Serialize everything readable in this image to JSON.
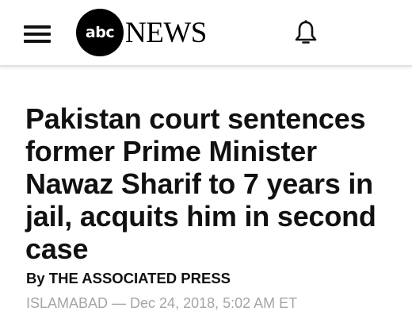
{
  "header": {
    "menu_icon": "hamburger-menu-icon",
    "logo": {
      "circle_text": "abc",
      "wordmark": "NEWS"
    },
    "notification_icon": "bell-icon"
  },
  "article": {
    "headline": "Pakistan court sentences former Prime Minister Nawaz Sharif to 7 years in jail, acquits him in second case",
    "byline": "By THE ASSOCIATED PRESS",
    "dateline": "ISLAMABAD — Dec 24, 2018, 5:02 AM ET"
  },
  "colors": {
    "background": "#ffffff",
    "text": "#111111",
    "muted_text": "#a5a5a5",
    "header_divider": "#e1e1e1"
  }
}
